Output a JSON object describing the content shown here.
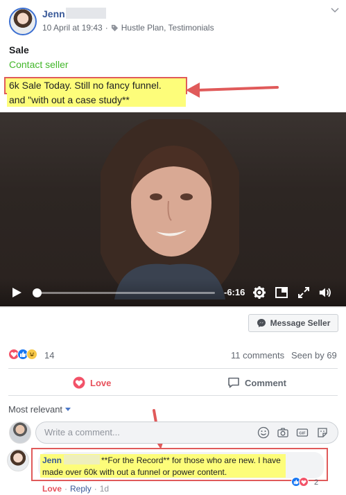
{
  "post": {
    "author": "Jenn",
    "date": "10 April at 19:43",
    "tags": "Hustle Plan, Testimonials",
    "title": "Sale",
    "contact_seller": "Contact seller",
    "text_line1": "6k Sale Today. Still no fancy funnel.",
    "text_line2": "and \"with out a case study**"
  },
  "video": {
    "time_remaining": "-6:16",
    "progress": 0.01
  },
  "message_seller": "Message Seller",
  "stats": {
    "reaction_count": "14",
    "comments": "11 comments",
    "seen_by": "Seen by 69"
  },
  "actions": {
    "love": "Love",
    "comment": "Comment"
  },
  "comments_section": {
    "sort_label": "Most relevant",
    "input_placeholder": "Write a comment...",
    "comment": {
      "author": "Jenn",
      "text_line1": "**For the Record** for those who are new. I have",
      "text_line2": "made over 60k with out a funnel or power content.",
      "reaction_count": "2",
      "love": "Love",
      "reply": "Reply",
      "time": "1d"
    }
  },
  "colors": {
    "link_blue": "#385898",
    "green": "#42b72a",
    "love_red": "#e7515b",
    "highlight_yellow": "#fdfd7a",
    "annotation_red": "#e05a5a"
  }
}
